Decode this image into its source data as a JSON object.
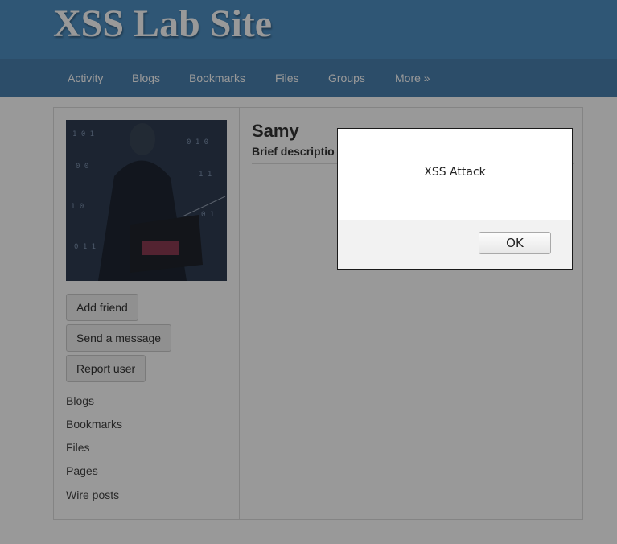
{
  "site": {
    "title": "XSS Lab Site"
  },
  "nav": {
    "items": [
      {
        "label": "Activity"
      },
      {
        "label": "Blogs"
      },
      {
        "label": "Bookmarks"
      },
      {
        "label": "Files"
      },
      {
        "label": "Groups"
      },
      {
        "label": "More »"
      }
    ]
  },
  "profile": {
    "name": "Samy",
    "brief_label": "Brief descriptio",
    "actions": {
      "add_friend": "Add friend",
      "send_message": "Send a message",
      "report_user": "Report user"
    },
    "links": [
      "Blogs",
      "Bookmarks",
      "Files",
      "Pages",
      "Wire posts"
    ]
  },
  "alert": {
    "message": "XSS Attack",
    "ok_label": "OK"
  },
  "colors": {
    "header": "#4f90c4",
    "navbar": "#4a80b0"
  }
}
